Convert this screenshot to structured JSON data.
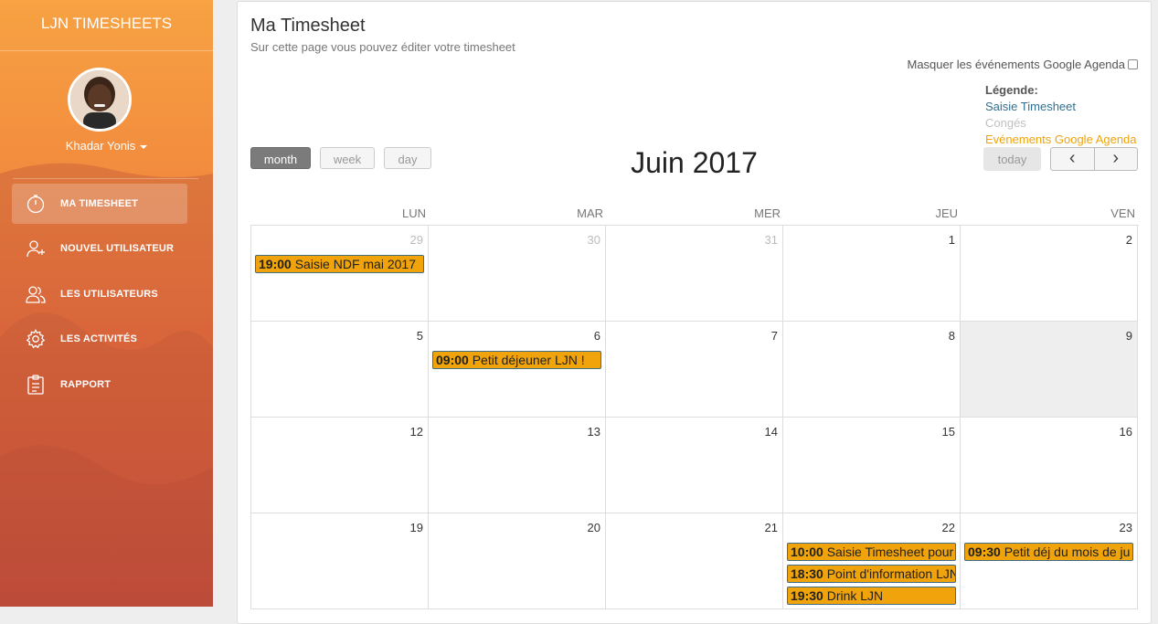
{
  "app": {
    "brand": "LJN TIMESHEETS"
  },
  "user": {
    "name": "Khadar Yonis"
  },
  "sidebar": {
    "items": [
      {
        "label": "MA TIMESHEET",
        "icon": "stopwatch-icon",
        "active": true
      },
      {
        "label": "NOUVEL UTILISATEUR",
        "icon": "add-user-icon",
        "active": false
      },
      {
        "label": "LES UTILISATEURS",
        "icon": "users-icon",
        "active": false
      },
      {
        "label": "LES ACTIVITÉS",
        "icon": "gear-icon",
        "active": false
      },
      {
        "label": "RAPPORT",
        "icon": "clipboard-icon",
        "active": false
      }
    ]
  },
  "page": {
    "title": "Ma Timesheet",
    "subtitle": "Sur cette page vous pouvez éditer votre timesheet",
    "hide_google_label": "Masquer les événements Google Agenda"
  },
  "legend": {
    "title": "Légende:",
    "items": [
      {
        "label": "Saisie Timesheet",
        "color": "#31708f"
      },
      {
        "label": "Congés",
        "color": "#c0c0c0"
      },
      {
        "label": "Evénements Google Agenda",
        "color": "#f0a30a"
      }
    ]
  },
  "calendar": {
    "title": "Juin 2017",
    "view_buttons": {
      "month": "month",
      "week": "week",
      "day": "day"
    },
    "active_view": "month",
    "today_label": "today",
    "prev_label": "‹",
    "next_label": "›",
    "day_headers": [
      "LUN",
      "MAR",
      "MER",
      "JEU",
      "VEN"
    ],
    "weeks": [
      [
        {
          "num": "29",
          "other": true
        },
        {
          "num": "30",
          "other": true
        },
        {
          "num": "31",
          "other": true
        },
        {
          "num": "1"
        },
        {
          "num": "2"
        }
      ],
      [
        {
          "num": "5"
        },
        {
          "num": "6"
        },
        {
          "num": "7"
        },
        {
          "num": "8"
        },
        {
          "num": "9",
          "today": true
        }
      ],
      [
        {
          "num": "12"
        },
        {
          "num": "13"
        },
        {
          "num": "14"
        },
        {
          "num": "15"
        },
        {
          "num": "16"
        }
      ],
      [
        {
          "num": "19"
        },
        {
          "num": "20"
        },
        {
          "num": "21"
        },
        {
          "num": "22"
        },
        {
          "num": "23"
        }
      ]
    ],
    "events": [
      {
        "week": 0,
        "day": 0,
        "time": "19:00",
        "title": "Saisie NDF mai 2017"
      },
      {
        "week": 1,
        "day": 1,
        "time": "09:00",
        "title": "Petit déjeuner LJN !"
      },
      {
        "week": 3,
        "day": 3,
        "time": "10:00",
        "title": "Saisie Timesheet pour"
      },
      {
        "week": 3,
        "day": 3,
        "time": "18:30",
        "title": "Point d'information LJN"
      },
      {
        "week": 3,
        "day": 3,
        "time": "19:30",
        "title": "Drink LJN"
      },
      {
        "week": 3,
        "day": 4,
        "time": "09:30",
        "title": "Petit déj du mois de ju"
      }
    ],
    "event_color": "#f0a30a"
  }
}
